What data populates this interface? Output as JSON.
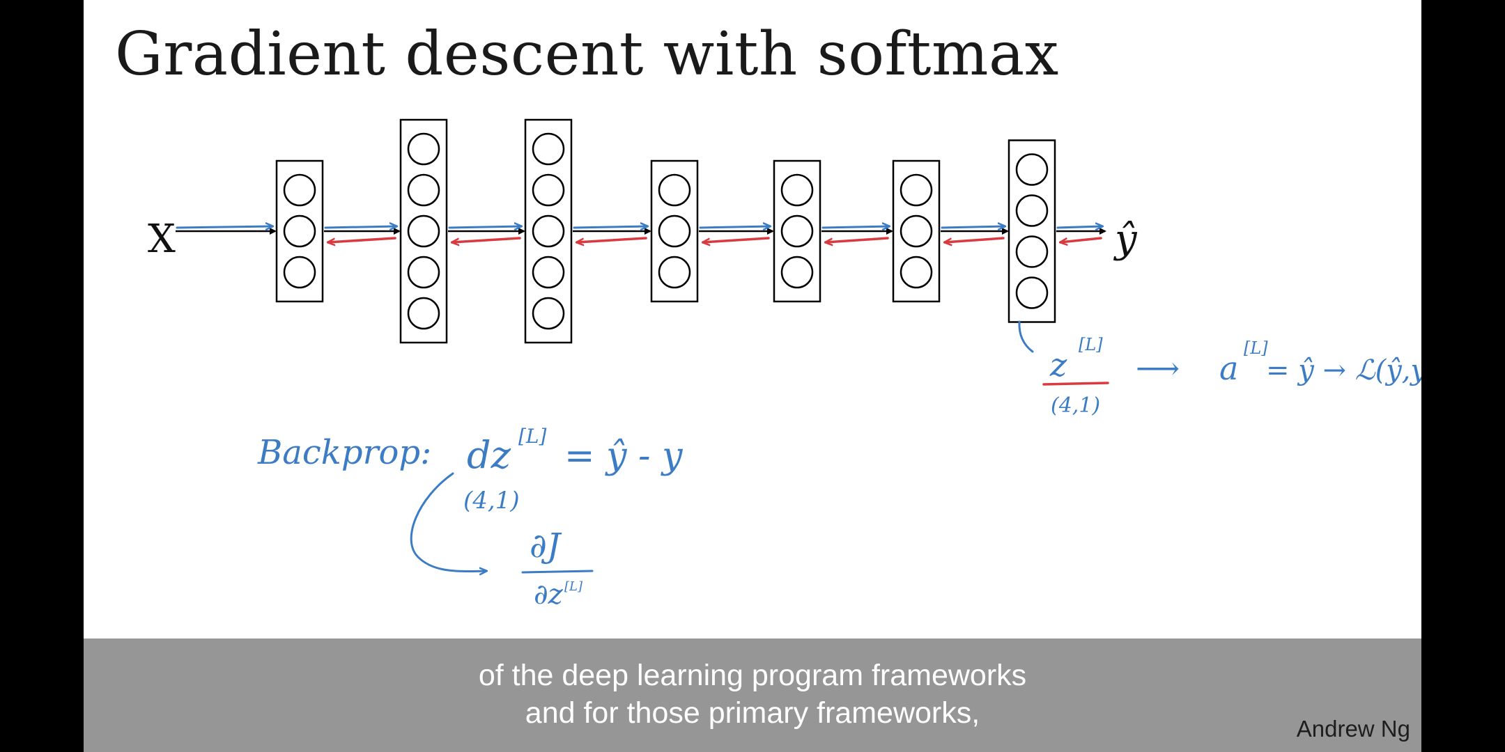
{
  "slide": {
    "title": "Gradient descent with softmax",
    "author": "Andrew Ng"
  },
  "network": {
    "input_label": "X",
    "output_label": "ŷ",
    "layer_node_counts": [
      3,
      5,
      5,
      3,
      3,
      3,
      4
    ]
  },
  "annotations": {
    "backprop_label": "Backprop:",
    "dz_label": "dz",
    "layer_superscript": "[L]",
    "dz_rhs": "= ŷ - y",
    "dz_shape": "(4,1)",
    "djdz_numerator": "∂J",
    "djdz_denominator": "∂z",
    "z_label": "z",
    "z_shape": "(4,1)",
    "arrow_symbol": "⟶",
    "a_label": "a",
    "a_rhs": "= ŷ → ℒ(ŷ,y)"
  },
  "subtitles": {
    "line1": "of the deep learning program frameworks",
    "line2": "and for those primary frameworks,"
  },
  "colors": {
    "ink_blue": "#3b7cc4",
    "ink_red": "#d93a40",
    "subtitle_bar": "#969696"
  }
}
